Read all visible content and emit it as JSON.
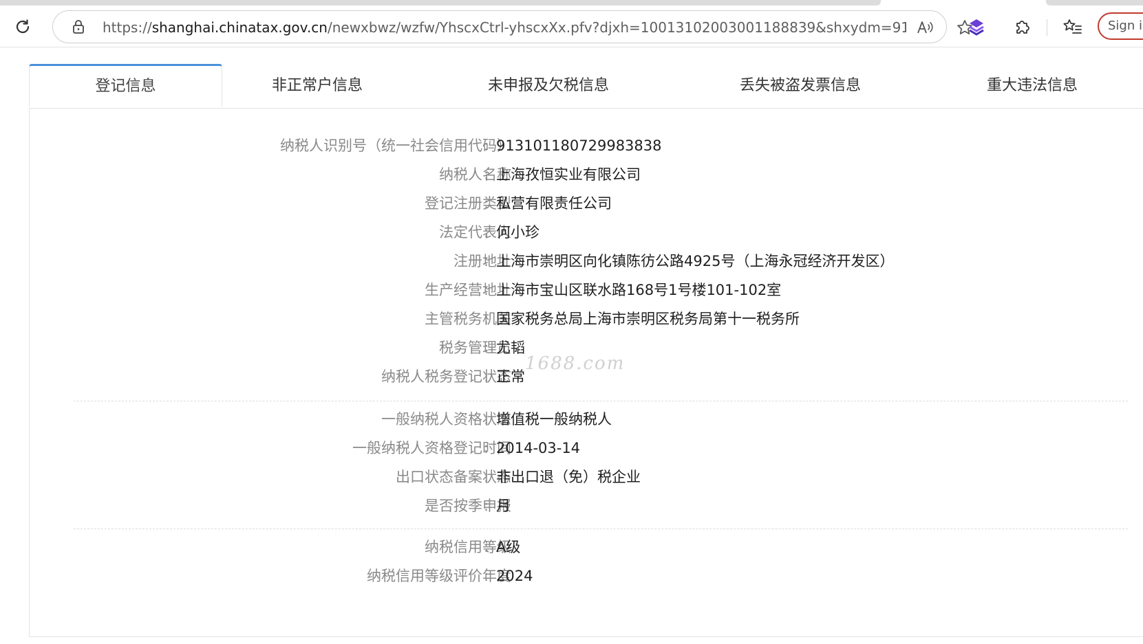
{
  "browser": {
    "url_prefix": "https://",
    "url_host": "shanghai.chinatax.gov.cn",
    "url_path": "/newxbwz/wzfw/YhscxCtrl-yhscxXx.pfv?djxh=10013102003001188839&shxydm=91...",
    "signin_label": "Sign in",
    "icons": {
      "reload": "reload-icon",
      "lock": "lock-icon",
      "read_aloud": "read-aloud-icon",
      "favorite": "star-icon",
      "copilot": "copilot-icon",
      "extensions": "puzzle-icon",
      "favorites_list": "favorites-list-icon"
    }
  },
  "tabs": [
    {
      "label": "登记信息",
      "active": true
    },
    {
      "label": "非正常户信息",
      "active": false
    },
    {
      "label": "未申报及欠税信息",
      "active": false
    },
    {
      "label": "丢失被盗发票信息",
      "active": false
    },
    {
      "label": "重大违法信息",
      "active": false
    }
  ],
  "colors": {
    "active_tab_accent": "#4a90d9",
    "label_gray": "#8a8a8a",
    "signin_border": "#c0392b"
  },
  "groups": [
    [
      {
        "label": "纳税人识别号（统一社会信用代码）",
        "value": "913101180729983838"
      },
      {
        "label": "纳税人名称",
        "value": "上海孜恒实业有限公司"
      },
      {
        "label": "登记注册类型",
        "value": "私营有限责任公司"
      },
      {
        "label": "法定代表人",
        "value": "何小珍"
      },
      {
        "label": "注册地址",
        "value": "上海市崇明区向化镇陈彷公路4925号（上海永冠经济开发区）"
      },
      {
        "label": "生产经营地址",
        "value": "上海市宝山区联水路168号1号楼101-102室"
      },
      {
        "label": "主管税务机关",
        "value": "国家税务总局上海市崇明区税务局第十一税务所"
      },
      {
        "label": "税务管理员",
        "value": "尤韬"
      },
      {
        "label": "纳税人税务登记状态",
        "value": "正常"
      }
    ],
    [
      {
        "label": "一般纳税人资格状态",
        "value": "增值税一般纳税人"
      },
      {
        "label": "一般纳税人资格登记时间",
        "value": "2014-03-14"
      },
      {
        "label": "出口状态备案状态",
        "value": "非出口退（免）税企业"
      },
      {
        "label": "是否按季申报",
        "value": "月"
      }
    ],
    [
      {
        "label": "纳税信用等级",
        "value": "A级"
      },
      {
        "label": "纳税信用等级评价年度",
        "value": "2024"
      }
    ]
  ],
  "watermark": "1688.com"
}
